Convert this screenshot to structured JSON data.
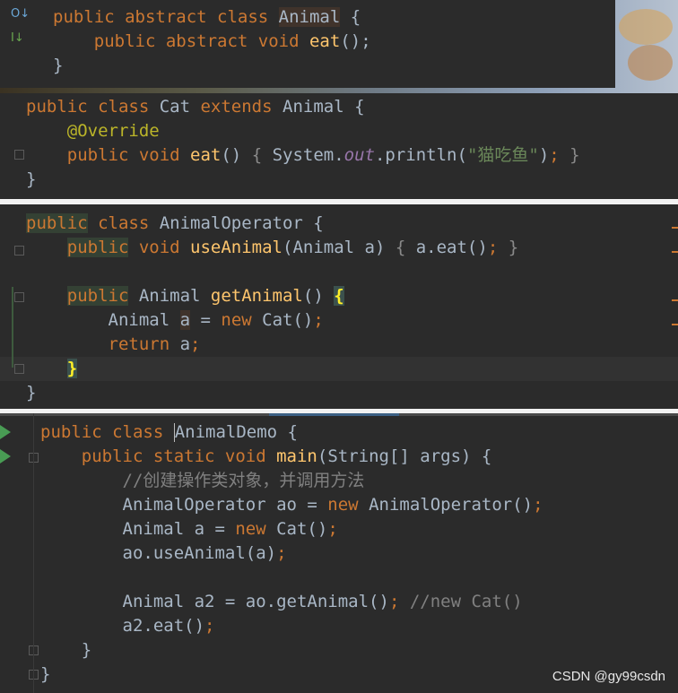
{
  "panel1": {
    "lines": [
      {
        "segments": [
          [
            "kw",
            "public abstract class "
          ],
          [
            "hl",
            "Animal"
          ],
          [
            "pl",
            " {"
          ]
        ]
      },
      {
        "segments": [
          [
            "kw",
            "    public abstract void "
          ],
          [
            "fn",
            "eat"
          ],
          [
            "pl",
            "();"
          ]
        ]
      },
      {
        "segments": [
          [
            "pl",
            "}"
          ]
        ]
      }
    ]
  },
  "panel2": {
    "lines": [
      {
        "segments": [
          [
            "kw",
            "public class "
          ],
          [
            "pl",
            "Cat "
          ],
          [
            "kw",
            "extends "
          ],
          [
            "pl",
            "Animal {"
          ]
        ]
      },
      {
        "segments": [
          [
            "an",
            "    @Override"
          ]
        ]
      },
      {
        "segments": [
          [
            "kw",
            "    public void "
          ],
          [
            "fn",
            "eat"
          ],
          [
            "pl",
            "() "
          ],
          [
            "dim",
            "{ "
          ],
          [
            "pl",
            "System."
          ],
          [
            "sf",
            "out"
          ],
          [
            "pl",
            ".println("
          ],
          [
            "st",
            "\"猫吃鱼\""
          ],
          [
            "pl",
            ")"
          ],
          [
            "kw",
            ";"
          ],
          [
            "dim",
            " }"
          ]
        ]
      },
      {
        "segments": [
          [
            "pl",
            "}"
          ]
        ]
      }
    ]
  },
  "panel3": {
    "lines": [
      {
        "segments": [
          [
            "hlkw",
            "public"
          ],
          [
            "kw",
            " class "
          ],
          [
            "pl",
            "AnimalOperator {"
          ]
        ]
      },
      {
        "segments": [
          [
            "pl",
            "    "
          ],
          [
            "hlkw",
            "public"
          ],
          [
            "kw",
            " void "
          ],
          [
            "fn",
            "useAnimal"
          ],
          [
            "pl",
            "(Animal a) "
          ],
          [
            "dim",
            "{ "
          ],
          [
            "pl",
            "a.eat()"
          ],
          [
            "kw",
            ";"
          ],
          [
            "dim",
            " }"
          ]
        ]
      },
      {
        "segments": [
          [
            "pl",
            ""
          ]
        ]
      },
      {
        "segments": [
          [
            "pl",
            "    "
          ],
          [
            "hlkw",
            "public"
          ],
          [
            "pl",
            " Animal "
          ],
          [
            "fn",
            "getAnimal"
          ],
          [
            "pl",
            "() "
          ],
          [
            "brace",
            "{"
          ]
        ]
      },
      {
        "segments": [
          [
            "pl",
            "        Animal "
          ],
          [
            "var",
            "a"
          ],
          [
            "pl",
            " = "
          ],
          [
            "kw",
            "new "
          ],
          [
            "pl",
            "Cat()"
          ],
          [
            "kw",
            ";"
          ]
        ]
      },
      {
        "segments": [
          [
            "kw",
            "        return "
          ],
          [
            "pl",
            "a"
          ],
          [
            "kw",
            ";"
          ]
        ]
      },
      {
        "segments": [
          [
            "pl",
            "    "
          ],
          [
            "brace",
            "}"
          ]
        ]
      },
      {
        "segments": [
          [
            "pl",
            "}"
          ]
        ]
      }
    ]
  },
  "panel4": {
    "lines": [
      {
        "segments": [
          [
            "kw",
            "public class "
          ],
          [
            "caret",
            ""
          ],
          [
            "pl",
            "AnimalDemo {"
          ]
        ]
      },
      {
        "segments": [
          [
            "kw",
            "    public static void "
          ],
          [
            "fn",
            "main"
          ],
          [
            "pl",
            "(String[] args) {"
          ]
        ]
      },
      {
        "segments": [
          [
            "cm",
            "        //创建操作类对象，并调用方法"
          ]
        ]
      },
      {
        "segments": [
          [
            "pl",
            "        AnimalOperator ao = "
          ],
          [
            "kw",
            "new "
          ],
          [
            "pl",
            "AnimalOperator()"
          ],
          [
            "kw",
            ";"
          ]
        ]
      },
      {
        "segments": [
          [
            "pl",
            "        Animal a = "
          ],
          [
            "kw",
            "new "
          ],
          [
            "pl",
            "Cat()"
          ],
          [
            "kw",
            ";"
          ]
        ]
      },
      {
        "segments": [
          [
            "pl",
            "        ao.useAnimal(a)"
          ],
          [
            "kw",
            ";"
          ]
        ]
      },
      {
        "segments": [
          [
            "pl",
            ""
          ]
        ]
      },
      {
        "segments": [
          [
            "pl",
            "        Animal a2 = ao.getAnimal()"
          ],
          [
            "kw",
            "; "
          ],
          [
            "cm",
            "//new Cat()"
          ]
        ]
      },
      {
        "segments": [
          [
            "pl",
            "        a2.eat()"
          ],
          [
            "kw",
            ";"
          ]
        ]
      },
      {
        "segments": [
          [
            "pl",
            "    }"
          ]
        ]
      },
      {
        "segments": [
          [
            "pl",
            "}"
          ]
        ]
      }
    ]
  },
  "watermark": "CSDN @gy99csdn",
  "gutter_icons": {
    "overridden": "O↓",
    "implemented": "I↓"
  }
}
